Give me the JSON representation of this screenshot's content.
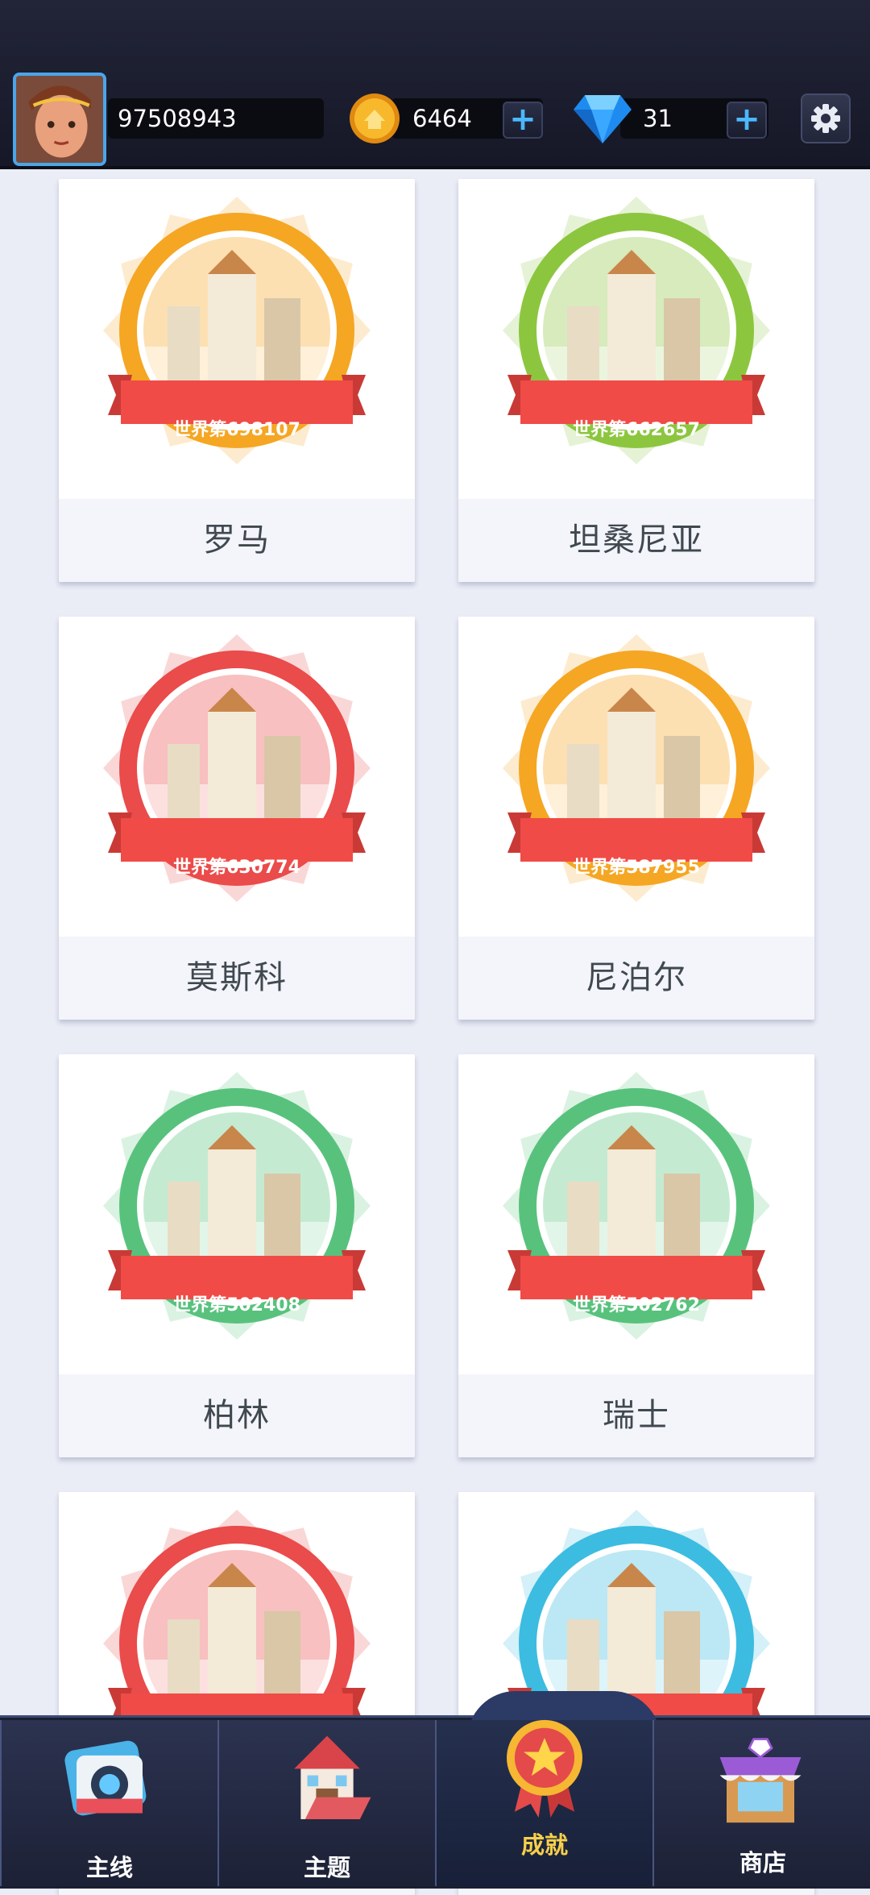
{
  "header": {
    "player_id": "97508943",
    "coins": "6464",
    "gems": "31",
    "icons": {
      "avatar": "player-avatar",
      "coin": "gold-coin-icon",
      "gem": "blue-diamond-icon",
      "plus": "plus-icon",
      "settings": "gear-icon"
    },
    "plus_symbol": "+"
  },
  "achievements": [
    {
      "name": "罗马",
      "rank": "世界第698107",
      "color": "#f5a623"
    },
    {
      "name": "坦桑尼亚",
      "rank": "世界第662657",
      "color": "#8cc63f"
    },
    {
      "name": "莫斯科",
      "rank": "世界第630774",
      "color": "#ea4b4b"
    },
    {
      "name": "尼泊尔",
      "rank": "世界第587955",
      "color": "#f5a623"
    },
    {
      "name": "柏林",
      "rank": "世界第502408",
      "color": "#58c27d"
    },
    {
      "name": "瑞士",
      "rank": "世界第502762",
      "color": "#58c27d"
    },
    {
      "name": "",
      "rank": "",
      "color": "#ea4b4b"
    },
    {
      "name": "",
      "rank": "",
      "color": "#3cbce0"
    }
  ],
  "bottom_nav": [
    {
      "label": "主线",
      "icon": "camera-icon",
      "active": false
    },
    {
      "label": "主题",
      "icon": "house-icon",
      "active": false
    },
    {
      "label": "成就",
      "icon": "medal-icon",
      "active": true
    },
    {
      "label": "商店",
      "icon": "shop-icon",
      "active": false
    }
  ],
  "colors": {
    "topbar": "#1c1e2e",
    "background": "#eaecf6",
    "ribbon": "#f04b47",
    "active_nav_label": "#f6d04a"
  }
}
